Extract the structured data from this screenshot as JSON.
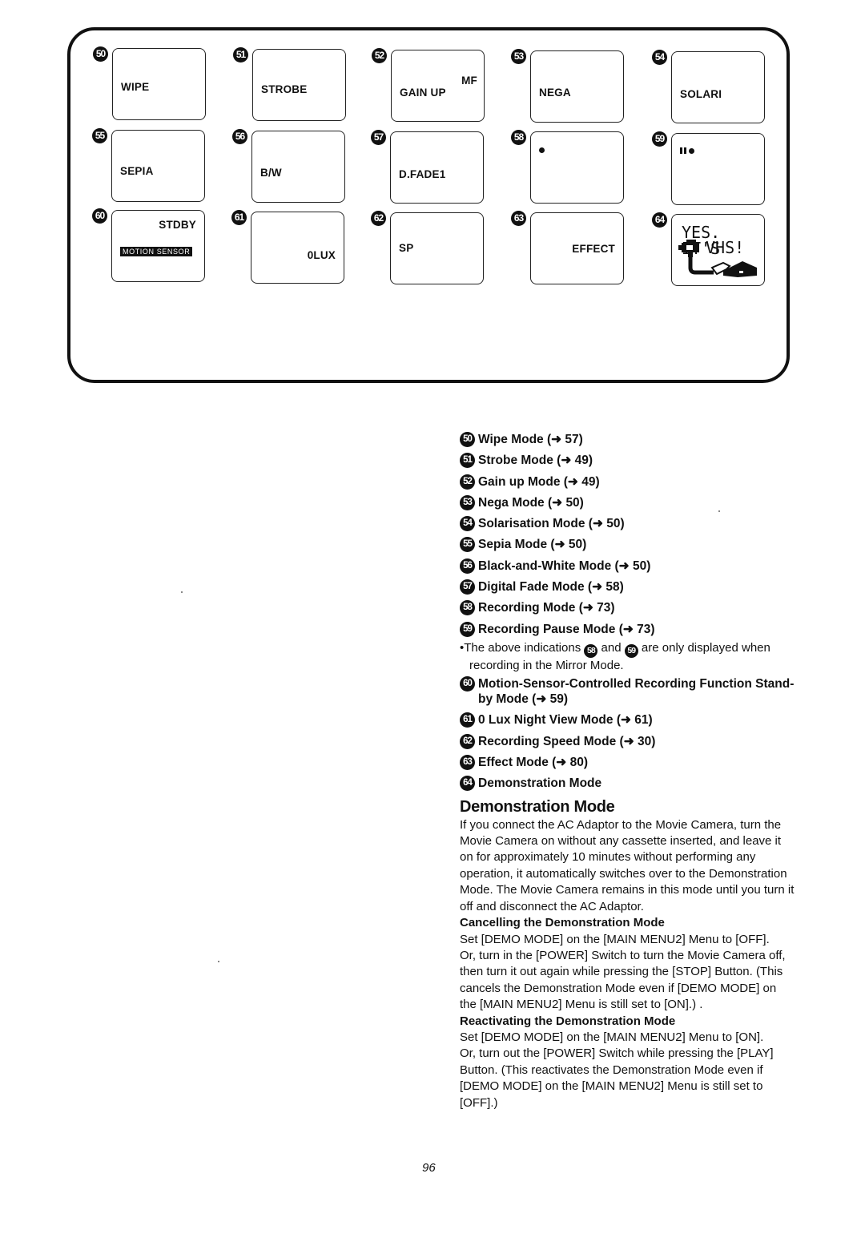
{
  "page": {
    "number": "96"
  },
  "display_panel": {
    "cells": [
      {
        "num": "50",
        "lines": [
          "WIPE"
        ]
      },
      {
        "num": "51",
        "lines": [
          "STROBE"
        ]
      },
      {
        "num": "52",
        "lines": [
          "GAIN UP",
          "MF"
        ]
      },
      {
        "num": "53",
        "lines": [
          "NEGA"
        ]
      },
      {
        "num": "54",
        "lines": [
          "SOLARI"
        ]
      },
      {
        "num": "55",
        "lines": [
          "SEPIA"
        ]
      },
      {
        "num": "56",
        "lines": [
          "B/W"
        ]
      },
      {
        "num": "57",
        "lines": [
          "D.FADE1"
        ]
      },
      {
        "num": "58",
        "icon": "record-dot-icon"
      },
      {
        "num": "59",
        "icon": "record-pause-icon"
      },
      {
        "num": "60",
        "lines": [
          "STDBY",
          "MOTION SENSOR"
        ]
      },
      {
        "num": "61",
        "lines": [
          "0LUX"
        ]
      },
      {
        "num": "62",
        "lines": [
          "SP"
        ]
      },
      {
        "num": "63",
        "lines": [
          "EFFECT"
        ]
      },
      {
        "num": "64",
        "lines": [
          "YES. IT'S",
          "VHS!"
        ],
        "icon": "camera-to-vcr-icon"
      }
    ]
  },
  "legend": {
    "items": [
      {
        "num": "50",
        "label": "Wipe Mode (➜ 57)"
      },
      {
        "num": "51",
        "label": "Strobe Mode (➜ 49)"
      },
      {
        "num": "52",
        "label": "Gain up Mode (➜ 49)"
      },
      {
        "num": "53",
        "label": "Nega Mode (➜ 50)"
      },
      {
        "num": "54",
        "label": "Solarisation Mode (➜ 50)"
      },
      {
        "num": "55",
        "label": "Sepia Mode (➜ 50)"
      },
      {
        "num": "56",
        "label": "Black-and-White Mode (➜ 50)"
      },
      {
        "num": "57",
        "label": "Digital Fade Mode (➜ 58)"
      },
      {
        "num": "58",
        "label": "Recording Mode (➜ 73)"
      },
      {
        "num": "59",
        "label": "Recording Pause Mode (➜ 73)"
      }
    ],
    "note": {
      "before": "The above indications",
      "ref1": "58",
      "middle": "and",
      "ref2": "59",
      "after": "are only displayed when recording in the Mirror Mode."
    },
    "items2": [
      {
        "num": "60",
        "label": "Motion-Sensor-Controlled Recording Function Stand-by Mode (➜ 59)"
      },
      {
        "num": "61",
        "label": "0 Lux Night View Mode (➜ 61)"
      },
      {
        "num": "62",
        "label": "Recording Speed Mode (➜ 30)"
      },
      {
        "num": "63",
        "label": "Effect Mode (➜ 80)"
      },
      {
        "num": "64",
        "label": "Demonstration Mode"
      }
    ]
  },
  "demo_section": {
    "title": "Demonstration Mode",
    "intro": "If you connect the AC Adaptor to the Movie Camera, turn the Movie Camera on without any cassette inserted, and leave it on for approximately 10 minutes without performing any operation, it automatically switches over to the Demonstration Mode. The Movie Camera remains in this mode until you turn it off and disconnect the AC Adaptor.",
    "cancel_heading": "Cancelling the Demonstration Mode",
    "cancel_p1": "Set [DEMO MODE] on the [MAIN MENU2] Menu to [OFF].",
    "cancel_p2": "Or, turn in the [POWER] Switch to turn the Movie Camera off, then turn it out again while pressing the [STOP] Button. (This cancels the Demonstration Mode even if [DEMO MODE] on the [MAIN MENU2] Menu is still set to [ON].) .",
    "reactivate_heading": "Reactivating the Demonstration Mode",
    "reactivate_p1": "Set [DEMO MODE] on the [MAIN MENU2] Menu to [ON].",
    "reactivate_p2": "Or, turn out the [POWER] Switch while pressing the [PLAY] Button. (This reactivates the Demonstration Mode even if [DEMO MODE] on the [MAIN MENU2] Menu is still set to [OFF].)"
  }
}
